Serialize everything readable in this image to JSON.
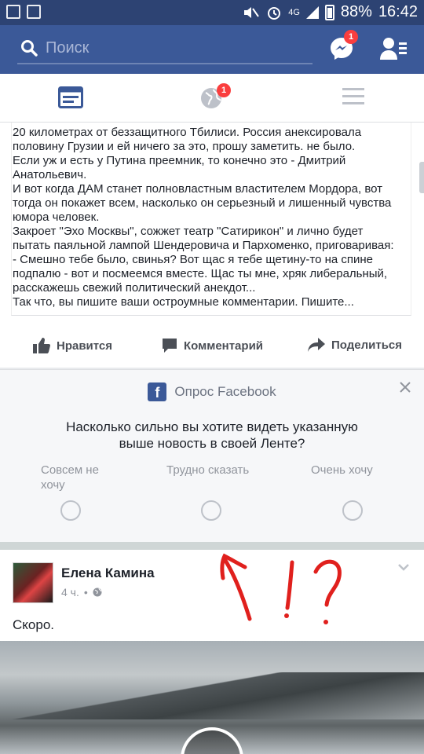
{
  "status_bar": {
    "battery": "88%",
    "time": "16:42",
    "network": "4G"
  },
  "search": {
    "placeholder": "Поиск"
  },
  "header": {
    "messenger_badge": "1"
  },
  "tabs": {
    "notifications_badge": "1"
  },
  "post": {
    "lines": [
      "20 километрах от беззащитного Тбилиси. Россия анексировала",
      "половину Грузии и ей ничего за это, прошу заметить. не было.",
      "Если уж и есть у Путина преемник, то конечно это - Дмитрий",
      "Анатольевич.",
      "И вот когда ДАМ станет полновластным властителем Мордора, вот",
      "тогда он покажет всем, насколько он серьезный и лишенный чувства",
      "юмора человек.",
      "Закроет \"Эхо Москвы\", сожжет театр \"Сатирикон\" и лично будет",
      "пытать паяльной лампой Шендеровича и Пархоменко, приговаривая:",
      "- Смешно тебе было, свинья? Вот щас я тебе щетину-то на спине",
      "подпалю - вот и посмеемся вместе. Щас ты мне, хряк либеральный,",
      "расскажешь свежий политический анекдот...",
      "Так что, вы пишите ваши остроумные комментарии. Пишите..."
    ],
    "actions": {
      "like": "Нравится",
      "comment": "Комментарий",
      "share": "Поделиться"
    }
  },
  "survey": {
    "title": "Опрос Facebook",
    "question_line1": "Насколько сильно вы хотите видеть указанную",
    "question_line2": "выше новость в своей Ленте?",
    "options": [
      {
        "label_line1": "Совсем не",
        "label_line2": "хочу"
      },
      {
        "label_line1": "Трудно сказать",
        "label_line2": ""
      },
      {
        "label_line1": "Очень хочу",
        "label_line2": ""
      }
    ]
  },
  "post2": {
    "author": "Елена Камина",
    "time": "4 ч.",
    "separator_dot": "•",
    "text": "Скоро."
  },
  "colors": {
    "brand": "#3b5998",
    "badge": "#fa3e3e",
    "annotation": "#e0201d"
  }
}
